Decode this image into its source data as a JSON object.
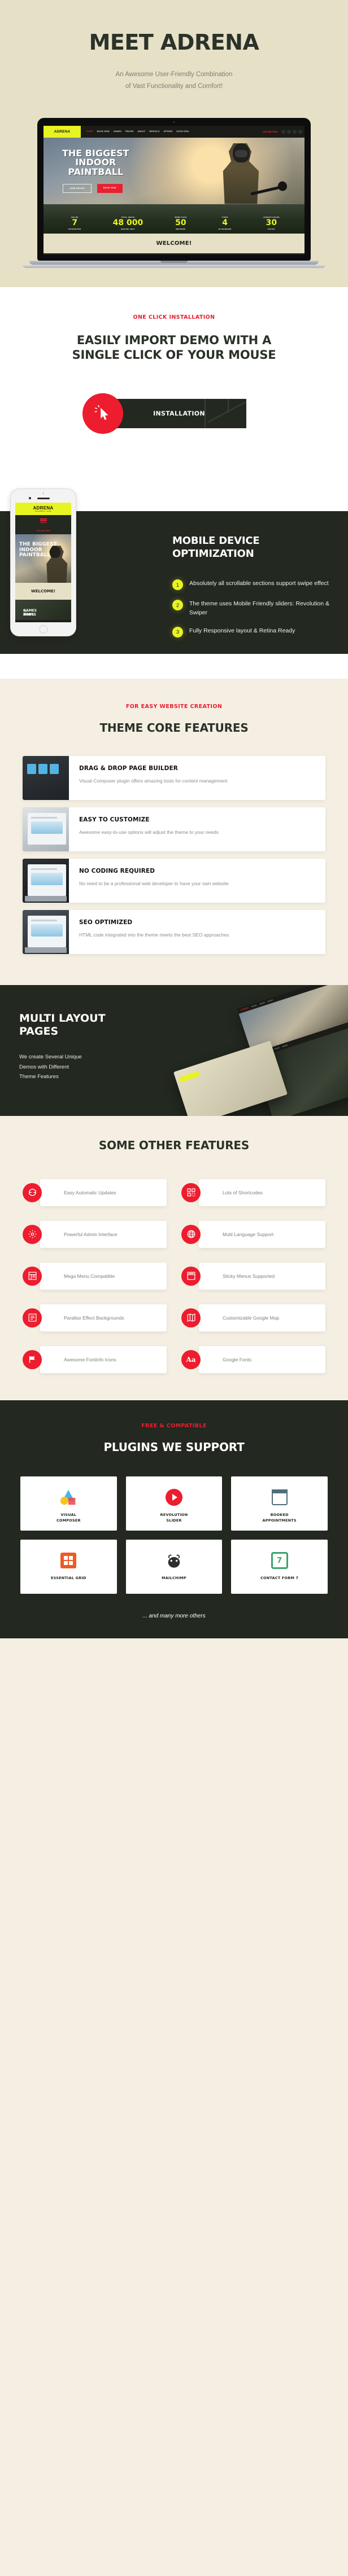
{
  "hero": {
    "title": "MEET ADRENA",
    "subtitle_line1": "An Awesome User-Friendly Combination",
    "subtitle_line2": "of Vast Functionality  and Comfort!",
    "laptop_site": {
      "logo": "ADRENA",
      "logo_tagline": "PAINTBALL CLUB",
      "menu": [
        "HOME",
        "BOOK NOW",
        "GAMES",
        "PRICES",
        "ABOUT",
        "RENTALS",
        "OFFERS",
        "GOOD IDEA"
      ],
      "phone": "123-456-7890",
      "hero_title_line1": "THE BIGGEST",
      "hero_title_line2": "INDOOR",
      "hero_title_line3": "PAINTBALL",
      "button_outline": "VIEW PRICES",
      "button_primary": "BOOK NOW",
      "counters": [
        {
          "caption_top": "FIELDS",
          "value": "7",
          "caption_bottom": "INTEGRATED"
        },
        {
          "caption_top": "TOTAL SPACE",
          "value": "48 000",
          "caption_bottom": "SQUARE FEET"
        },
        {
          "caption_top": "MORE THAN",
          "value": "50",
          "caption_bottom": "MISSIONS"
        },
        {
          "caption_top": "TYPES",
          "value": "4",
          "caption_bottom": "OF MARKERS"
        },
        {
          "caption_top": "AIRSOFT FIELDS",
          "value": "30",
          "caption_bottom": "FIELDS"
        }
      ],
      "welcome": "WELCOME!"
    }
  },
  "install": {
    "eyebrow": "ONE CLICK INSTALLATION",
    "title_line1": "EASILY IMPORT DEMO WITH A",
    "title_line2": "SINGLE CLICK OF YOUR MOUSE",
    "button_label": "INSTALLATION",
    "cursor_icon": "click-cursor-icon",
    "box_icon": "package-box-icon"
  },
  "mobile": {
    "title_line1": "MOBILE DEVICE",
    "title_line2": "OPTIMIZATION",
    "items": [
      {
        "num": "1",
        "text": "Absolutely all scrollable sections support swipe effect"
      },
      {
        "num": "2",
        "text": "The theme uses Mobile Friendly sliders: Revolution & Swiper"
      },
      {
        "num": "3",
        "text": "Fully Responsive layout & Retina Ready"
      }
    ],
    "phone_site": {
      "logo": "ADRENA",
      "logo_tagline": "PAINTBALL CLUB",
      "phone": "123-456-7890",
      "hero_line1": "THE BIGGEST",
      "hero_line2": "INDOOR",
      "hero_line3": "PAINTBALL",
      "welcome": "WELCOME!",
      "games_line1": "GAMES ZONES",
      "games_line2": "& MAPS"
    }
  },
  "core": {
    "eyebrow": "FOR EASY WEBSITE CREATION",
    "title": "THEME CORE FEATURES",
    "cards": [
      {
        "title": "DRAG & DROP PAGE BUILDER",
        "text": "Visual  Composer plugin offers amazing tools for content management",
        "thumb_icon": "page-builder-screenshot"
      },
      {
        "title": "EASY TO CUSTOMIZE",
        "text": "Awesome easy-to-use options will adjust the theme to your needs",
        "thumb_icon": "customize-screenshot"
      },
      {
        "title": "NO CODING REQUIRED",
        "text": "No need to be a professional web developer to have your own website",
        "thumb_icon": "no-coding-screenshot"
      },
      {
        "title": "SEO OPTIMIZED",
        "text": "HTML code integrated into the theme meets the best SEO approaches",
        "thumb_icon": "seo-screenshot"
      }
    ]
  },
  "multi": {
    "title_line1": "MULTI LAYOUT",
    "title_line2": "PAGES",
    "text_line1": "We create Several Unique",
    "text_line2": "Demos with Different",
    "text_line3": "Theme Features"
  },
  "other": {
    "title": "SOME OTHER FEATURES",
    "features": [
      {
        "label": "Easy Automatic Updates",
        "icon": "refresh-icon"
      },
      {
        "label": "Lots of Shortcodes",
        "icon": "shortcodes-grid-icon"
      },
      {
        "label": "Powerful Admin Interface",
        "icon": "gear-icon"
      },
      {
        "label": "Multi Language Support",
        "icon": "globe-icon"
      },
      {
        "label": "Mega Menu Compatible",
        "icon": "mega-menu-icon"
      },
      {
        "label": "Sticky Menus Supported",
        "icon": "sticky-menu-icon"
      },
      {
        "label": "Parallax Effect Backgrounds",
        "icon": "layers-icon"
      },
      {
        "label": "Customizable Google Map",
        "icon": "map-icon"
      },
      {
        "label": "Awesome Fontinfo Icons",
        "icon": "flag-icon"
      },
      {
        "label": "Google Fonts",
        "icon": "aa-typography-icon"
      }
    ]
  },
  "plugins": {
    "eyebrow": "FREE & COMPATIBLE",
    "title": "PLUGINS WE SUPPORT",
    "items": [
      {
        "name_line1": "VISUAL",
        "name_line2": "COMPOSER",
        "icon": "visual-composer-icon"
      },
      {
        "name_line1": "REVOLUTION",
        "name_line2": "SLIDER",
        "icon": "revolution-slider-icon"
      },
      {
        "name_line1": "BOOKED",
        "name_line2": "APPOINTMENTS",
        "icon": "booked-appointments-icon"
      },
      {
        "name_line1": "ESSENTIAL GRID",
        "name_line2": "",
        "icon": "essential-grid-icon"
      },
      {
        "name_line1": "MAILCHIMP",
        "name_line2": "",
        "icon": "mailchimp-icon"
      },
      {
        "name_line1": "CONTACT FORM 7",
        "name_line2": "",
        "icon": "contact-form-7-icon"
      }
    ],
    "footer_note": "... and many more others"
  },
  "colors": {
    "cream": "#e6e0c6",
    "page_bg": "#f4efe2",
    "dark": "#232820",
    "red": "#ed1c2e",
    "yellow": "#e8f322"
  }
}
